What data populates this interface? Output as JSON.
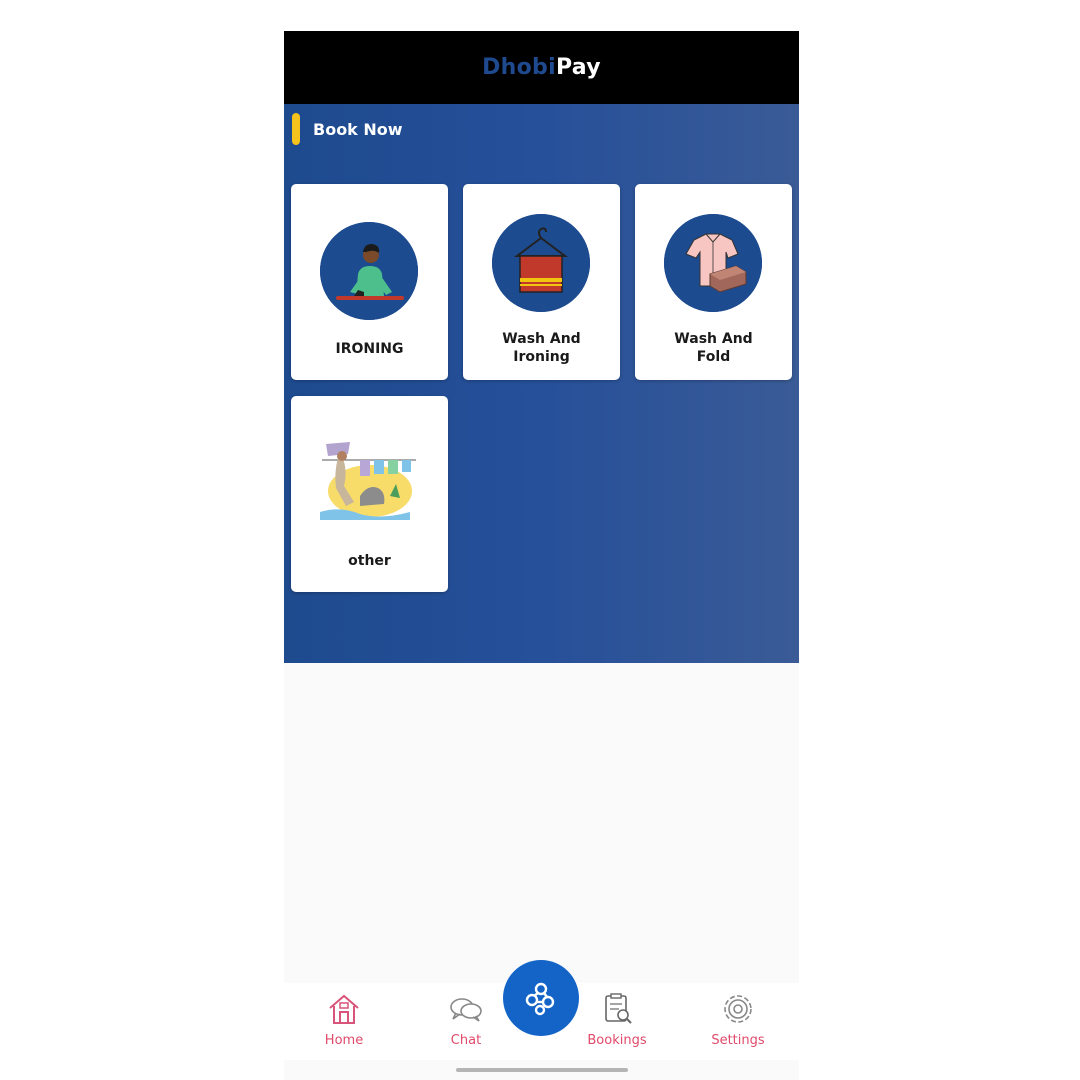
{
  "app": {
    "brand_part1": "Dhobi",
    "brand_part2": "Pay"
  },
  "section": {
    "title": "Book Now"
  },
  "services": [
    {
      "label": "IRONING",
      "icon": "ironing-icon"
    },
    {
      "label_line1": "Wash And",
      "label_line2": "Ironing",
      "icon": "hanger-towel-icon"
    },
    {
      "label_line1": "Wash And",
      "label_line2": "Fold",
      "icon": "folded-shirt-icon"
    },
    {
      "label": "other",
      "icon": "laundry-line-icon"
    }
  ],
  "nav": {
    "home": "Home",
    "chat": "Chat",
    "bookings": "Bookings",
    "settings": "Settings"
  },
  "colors": {
    "header": "#000000",
    "hero": "#26509a",
    "accent": "#f6c21c",
    "fab": "#1464c8",
    "nav_label": "#e04a6a"
  }
}
